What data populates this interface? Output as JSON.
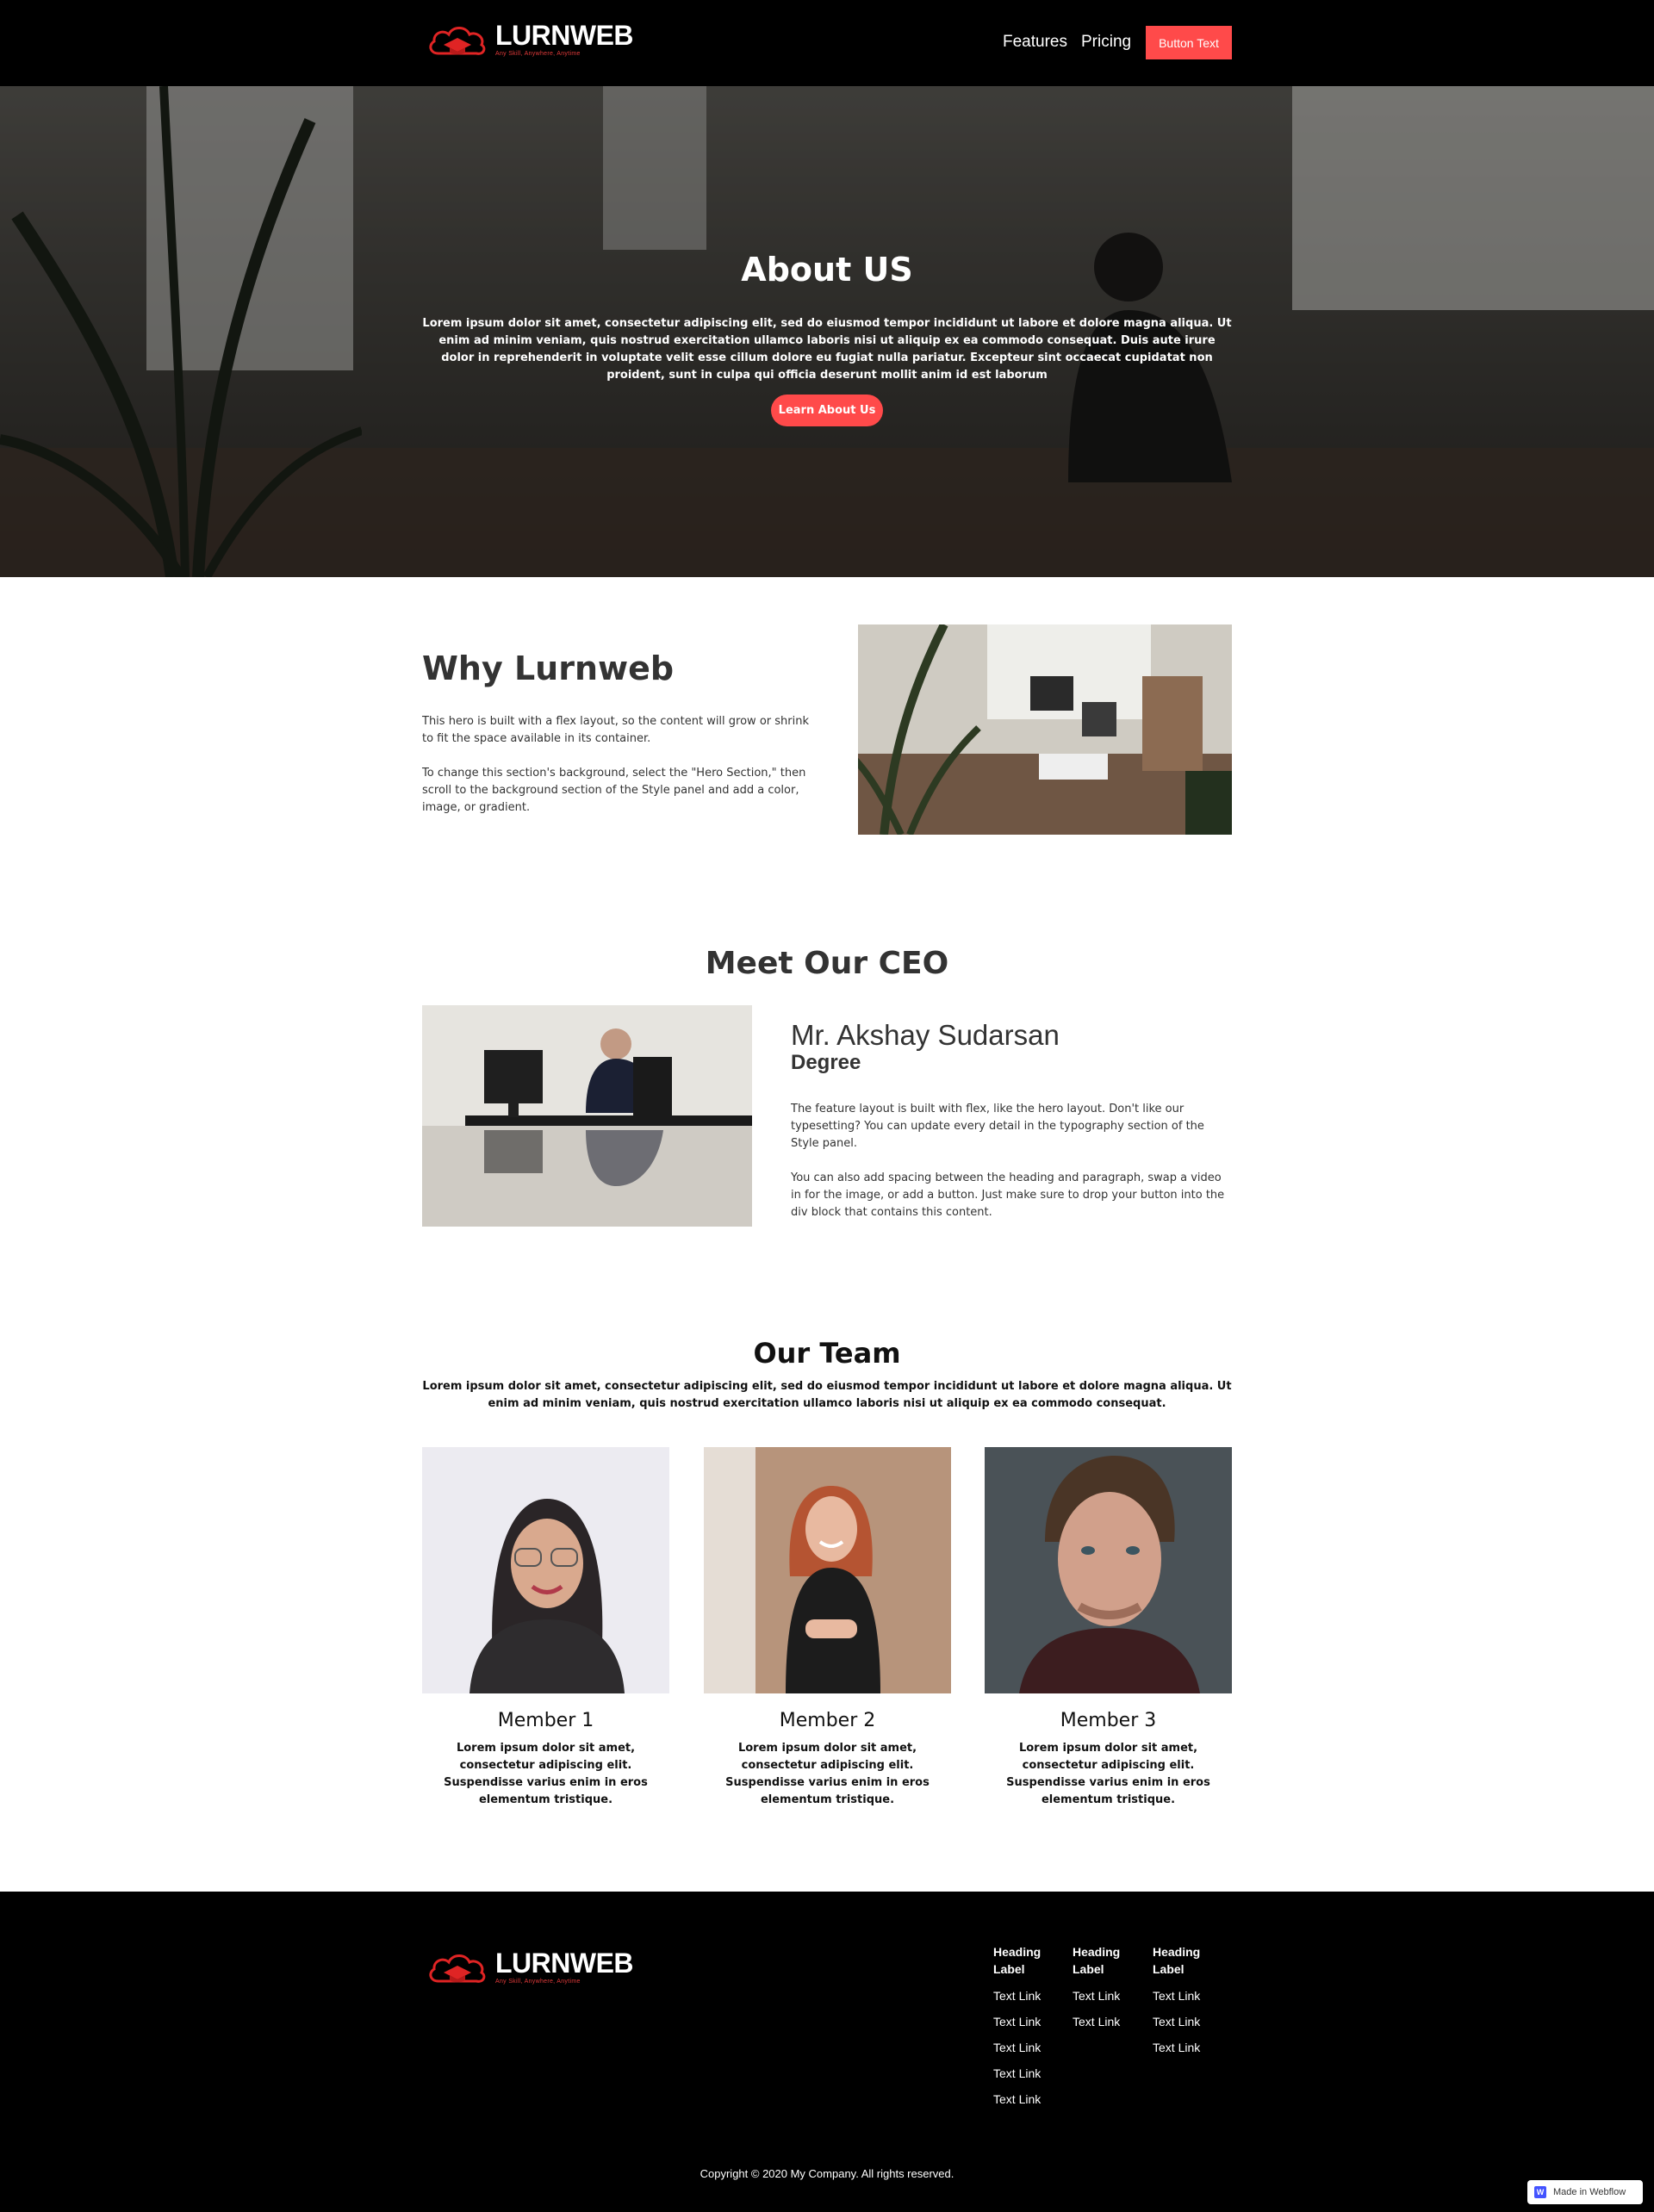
{
  "nav": {
    "brand_name": "LURNWEB",
    "brand_tagline": "Any Skill, Anywhere, Anytime",
    "links": [
      {
        "label": "Features"
      },
      {
        "label": "Pricing"
      }
    ],
    "button_label": "Button Text"
  },
  "hero": {
    "title": "About US",
    "text": "Lorem ipsum dolor sit amet, consectetur adipiscing elit, sed do eiusmod tempor incididunt ut labore et dolore magna aliqua. Ut enim ad minim veniam, quis nostrud exercitation ullamco laboris nisi ut aliquip ex ea commodo consequat. Duis aute irure dolor in reprehenderit in voluptate velit esse cillum dolore eu fugiat nulla pariatur. Excepteur sint occaecat cupidatat non proident, sunt in culpa qui officia deserunt mollit anim id est laborum",
    "button_label": "Learn About Us"
  },
  "why": {
    "title": "Why Lurnweb",
    "paragraph_1": "This hero is built with a flex layout, so the content will grow or shrink to fit the space available in its container.",
    "paragraph_2": "To change this section's background, select the \"Hero Section,\" then scroll to the background section of the Style panel and add a color, image, or gradient."
  },
  "ceo": {
    "heading": "Meet Our CEO",
    "name": "Mr. Akshay Sudarsan",
    "degree": "Degree",
    "paragraph_1": "The feature layout is built with flex, like the hero layout. Don't like our typesetting? You can update every detail in the typography section of the Style panel.",
    "paragraph_2": "You can also add spacing between the heading and paragraph, swap a video in for the image, or add a button. Just make sure to drop your button into the div block that contains this content."
  },
  "team": {
    "heading": "Our Team",
    "intro": "Lorem ipsum dolor sit amet, consectetur adipiscing elit, sed do eiusmod tempor incididunt ut labore et dolore magna aliqua. Ut enim ad minim veniam, quis nostrud exercitation ullamco laboris nisi ut aliquip ex ea commodo consequat.",
    "members": [
      {
        "name": "Member 1",
        "description": "Lorem ipsum dolor sit amet, consectetur adipiscing elit. Suspendisse varius enim in eros elementum tristique."
      },
      {
        "name": "Member 2",
        "description": "Lorem ipsum dolor sit amet, consectetur adipiscing elit. Suspendisse varius enim in eros elementum tristique."
      },
      {
        "name": "Member 3",
        "description": "Lorem ipsum dolor sit amet, consectetur adipiscing elit. Suspendisse varius enim in eros elementum tristique."
      }
    ]
  },
  "footer": {
    "brand_name": "LURNWEB",
    "brand_tagline": "Any Skill, Anywhere, Anytime",
    "columns": [
      {
        "heading": "Heading Label",
        "links": [
          "Text Link",
          "Text Link",
          "Text Link",
          "Text Link",
          "Text Link"
        ]
      },
      {
        "heading": "Heading Label",
        "links": [
          "Text Link",
          "Text Link"
        ]
      },
      {
        "heading": "Heading Label",
        "links": [
          "Text Link",
          "Text Link",
          "Text Link"
        ]
      }
    ],
    "copyright": "Copyright © 2020 My Company. All rights reserved.",
    "badge_label": "Made in Webflow"
  },
  "colors": {
    "accent": "#ff4a4a",
    "nav_bg": "#000000",
    "footer_bg": "#000000"
  }
}
